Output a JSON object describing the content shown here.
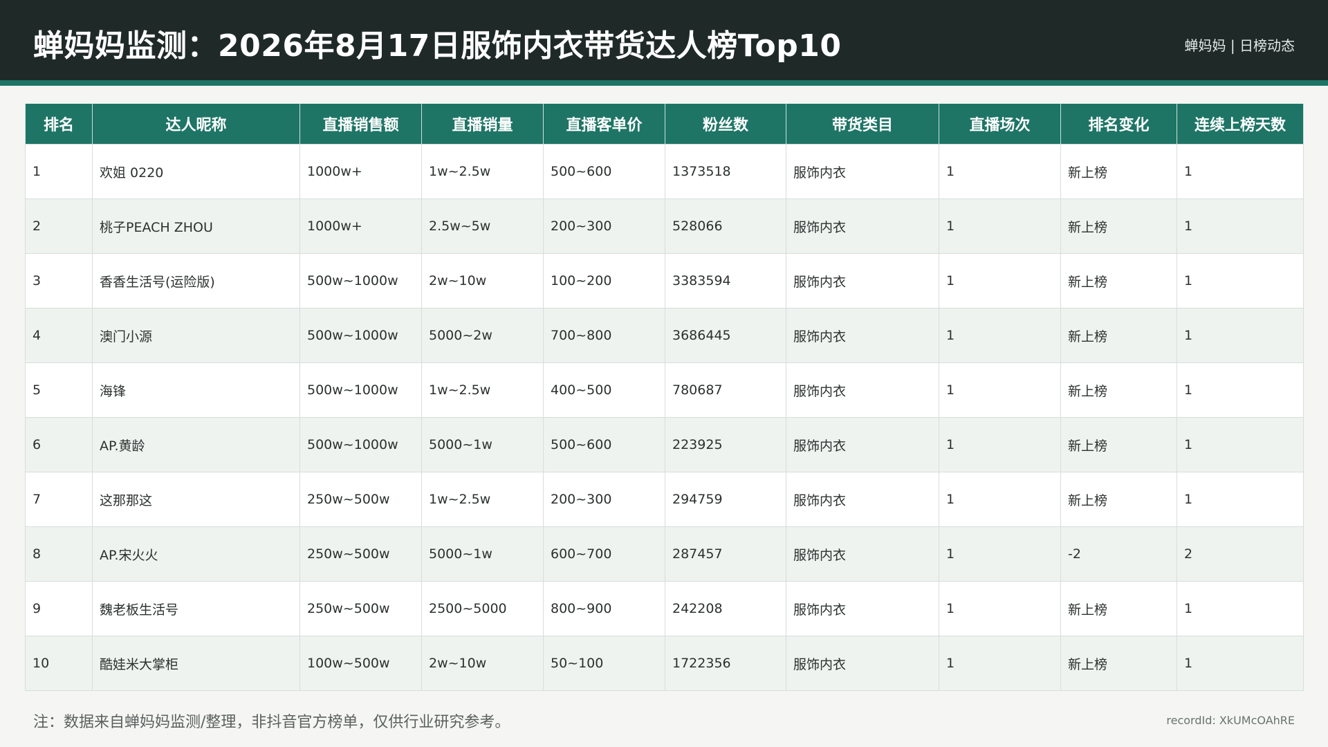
{
  "header": {
    "title": "蝉妈妈监测：2026年8月17日服饰内衣带货达人榜Top10",
    "brand_meta": "蝉妈妈 | 日榜动态"
  },
  "table": {
    "columns": [
      "排名",
      "达人昵称",
      "直播销售额",
      "直播销量",
      "直播客单价",
      "粉丝数",
      "带货类目",
      "直播场次",
      "排名变化",
      "连续上榜天数"
    ],
    "rows": [
      [
        "1",
        "欢姐 0220",
        "1000w+",
        "1w~2.5w",
        "500~600",
        "1373518",
        "服饰内衣",
        "1",
        "新上榜",
        "1"
      ],
      [
        "2",
        "桃子PEACH ZHOU",
        "1000w+",
        "2.5w~5w",
        "200~300",
        "528066",
        "服饰内衣",
        "1",
        "新上榜",
        "1"
      ],
      [
        "3",
        "香香生活号(运险版)",
        "500w~1000w",
        "2w~10w",
        "100~200",
        "3383594",
        "服饰内衣",
        "1",
        "新上榜",
        "1"
      ],
      [
        "4",
        "澳门小源",
        "500w~1000w",
        "5000~2w",
        "700~800",
        "3686445",
        "服饰内衣",
        "1",
        "新上榜",
        "1"
      ],
      [
        "5",
        "海锋",
        "500w~1000w",
        "1w~2.5w",
        "400~500",
        "780687",
        "服饰内衣",
        "1",
        "新上榜",
        "1"
      ],
      [
        "6",
        "AP.黄龄",
        "500w~1000w",
        "5000~1w",
        "500~600",
        "223925",
        "服饰内衣",
        "1",
        "新上榜",
        "1"
      ],
      [
        "7",
        "这那那这",
        "250w~500w",
        "1w~2.5w",
        "200~300",
        "294759",
        "服饰内衣",
        "1",
        "新上榜",
        "1"
      ],
      [
        "8",
        "AP.宋火火",
        "250w~500w",
        "5000~1w",
        "600~700",
        "287457",
        "服饰内衣",
        "1",
        "-2",
        "2"
      ],
      [
        "9",
        "魏老板生活号",
        "250w~500w",
        "2500~5000",
        "800~900",
        "242208",
        "服饰内衣",
        "1",
        "新上榜",
        "1"
      ],
      [
        "10",
        "酷娃米大掌柜",
        "100w~500w",
        "2w~10w",
        "50~100",
        "1722356",
        "服饰内衣",
        "1",
        "新上榜",
        "1"
      ]
    ]
  },
  "footer": {
    "note": "注：数据来自蝉妈妈监测/整理，非抖音官方榜单，仅供行业研究参考。",
    "record_id": "recordId: XkUMcOAhRE"
  },
  "colors": {
    "header_bg": "#1f2a28",
    "accent": "#1e7566",
    "row_alt": "#eef3f0"
  }
}
